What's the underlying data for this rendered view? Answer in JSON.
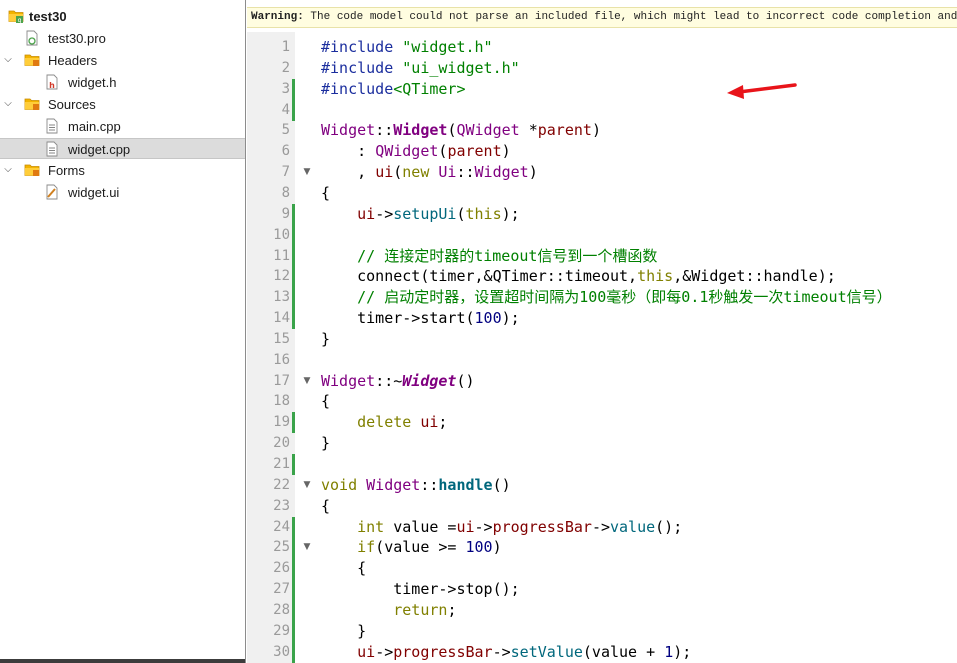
{
  "tree": {
    "items": [
      {
        "label": "test30",
        "level": 0,
        "kind": "project",
        "expanded": true,
        "bold": true
      },
      {
        "label": "test30.pro",
        "level": 1,
        "kind": "pro-file"
      },
      {
        "label": "Headers",
        "level": 1,
        "kind": "folder",
        "expanded": true
      },
      {
        "label": "widget.h",
        "level": 2,
        "kind": "header-file"
      },
      {
        "label": "Sources",
        "level": 1,
        "kind": "folder",
        "expanded": true
      },
      {
        "label": "main.cpp",
        "level": 2,
        "kind": "source-file"
      },
      {
        "label": "widget.cpp",
        "level": 2,
        "kind": "source-file",
        "selected": true
      },
      {
        "label": "Forms",
        "level": 1,
        "kind": "folder",
        "expanded": true
      },
      {
        "label": "widget.ui",
        "level": 2,
        "kind": "ui-file"
      }
    ]
  },
  "editor": {
    "warning_title": "Warning:",
    "warning_text": " The code model could not parse an included file, which might lead to incorrect code completion and highlighting, for example.",
    "line_numbers": [
      "1",
      "2",
      "3",
      "4",
      "5",
      "6",
      "7",
      "8",
      "9",
      "10",
      "11",
      "12",
      "13",
      "14",
      "15",
      "16",
      "17",
      "18",
      "19",
      "20",
      "21",
      "22",
      "23",
      "24",
      "25",
      "26",
      "27",
      "28",
      "29",
      "30"
    ],
    "changed_lines": [
      3,
      4,
      9,
      10,
      11,
      12,
      13,
      14,
      19,
      21,
      24,
      25,
      26,
      27,
      28,
      29,
      30
    ],
    "fold_lines": [
      7,
      17,
      22,
      25
    ],
    "lines": [
      [
        [
          "dir",
          "#include "
        ],
        [
          "str",
          "\"widget.h\""
        ]
      ],
      [
        [
          "dir",
          "#include "
        ],
        [
          "str",
          "\"ui_widget.h\""
        ]
      ],
      [
        [
          "dir",
          "#include"
        ],
        [
          "str",
          "<QTimer>"
        ]
      ],
      [],
      [
        [
          "type",
          "Widget"
        ],
        [
          "",
          "::"
        ],
        [
          "type-bold",
          "Widget"
        ],
        [
          "",
          "("
        ],
        [
          "type",
          "QWidget"
        ],
        [
          "",
          " *"
        ],
        [
          "mem",
          "parent"
        ],
        [
          "",
          ")"
        ]
      ],
      [
        [
          "",
          "    : "
        ],
        [
          "type",
          "QWidget"
        ],
        [
          "",
          "("
        ],
        [
          "mem",
          "parent"
        ],
        [
          "",
          ")"
        ]
      ],
      [
        [
          "",
          "    , "
        ],
        [
          "mem",
          "ui"
        ],
        [
          "",
          "("
        ],
        [
          "key",
          "new"
        ],
        [
          "",
          " "
        ],
        [
          "type",
          "Ui"
        ],
        [
          "",
          "::"
        ],
        [
          "type",
          "Widget"
        ],
        [
          "",
          ")"
        ]
      ],
      [
        [
          "",
          "{"
        ]
      ],
      [
        [
          "",
          "    "
        ],
        [
          "mem",
          "ui"
        ],
        [
          "",
          "->"
        ],
        [
          "fn",
          "setupUi"
        ],
        [
          "",
          "("
        ],
        [
          "key",
          "this"
        ],
        [
          "",
          ");"
        ]
      ],
      [],
      [
        [
          "cmt",
          "    // 连接定时器的timeout信号到一个槽函数"
        ]
      ],
      [
        [
          "",
          "    connect(timer,&QTimer::timeout,"
        ],
        [
          "key",
          "this"
        ],
        [
          "",
          ",&Widget::handle);"
        ]
      ],
      [
        [
          "cmt",
          "    // 启动定时器，设置超时间隔为100毫秒（即每0.1秒触发一次timeout信号）"
        ]
      ],
      [
        [
          "",
          "    timer->start("
        ],
        [
          "num",
          "100"
        ],
        [
          "",
          ");"
        ]
      ],
      [
        [
          "",
          "}"
        ]
      ],
      [],
      [
        [
          "type",
          "Widget"
        ],
        [
          "",
          "::~"
        ],
        [
          "type-ital",
          "Widget"
        ],
        [
          "",
          "()"
        ]
      ],
      [
        [
          "",
          "{"
        ]
      ],
      [
        [
          "",
          "    "
        ],
        [
          "key",
          "delete"
        ],
        [
          "",
          " "
        ],
        [
          "mem",
          "ui"
        ],
        [
          "",
          ";"
        ]
      ],
      [
        [
          "",
          "}"
        ]
      ],
      [],
      [
        [
          "key",
          "void"
        ],
        [
          "",
          " "
        ],
        [
          "type",
          "Widget"
        ],
        [
          "",
          "::"
        ],
        [
          "fn-bold",
          "handle"
        ],
        [
          "",
          "()"
        ]
      ],
      [
        [
          "",
          "{"
        ]
      ],
      [
        [
          "",
          "    "
        ],
        [
          "key",
          "int"
        ],
        [
          "",
          " "
        ],
        [
          "",
          "value ="
        ],
        [
          "mem",
          "ui"
        ],
        [
          "",
          "->"
        ],
        [
          "mem",
          "progressBar"
        ],
        [
          "",
          "->"
        ],
        [
          "fn",
          "value"
        ],
        [
          "",
          "();"
        ]
      ],
      [
        [
          "",
          "    "
        ],
        [
          "key",
          "if"
        ],
        [
          "",
          "(value >= "
        ],
        [
          "num",
          "100"
        ],
        [
          "",
          ")"
        ]
      ],
      [
        [
          "",
          "    {"
        ]
      ],
      [
        [
          "",
          "        timer->stop();"
        ]
      ],
      [
        [
          "",
          "        "
        ],
        [
          "key",
          "return"
        ],
        [
          "",
          ";"
        ]
      ],
      [
        [
          "",
          "    }"
        ]
      ],
      [
        [
          "",
          "    "
        ],
        [
          "mem",
          "ui"
        ],
        [
          "",
          "->"
        ],
        [
          "mem",
          "progressBar"
        ],
        [
          "",
          "->"
        ],
        [
          "fn",
          "setValue"
        ],
        [
          "",
          "(value + "
        ],
        [
          "num",
          "1"
        ],
        [
          "",
          ");"
        ]
      ]
    ]
  },
  "colors": {
    "accent_arrow": "#e8141a",
    "change_marker": "#3aa34a",
    "warning_bg": "#fffde0"
  }
}
